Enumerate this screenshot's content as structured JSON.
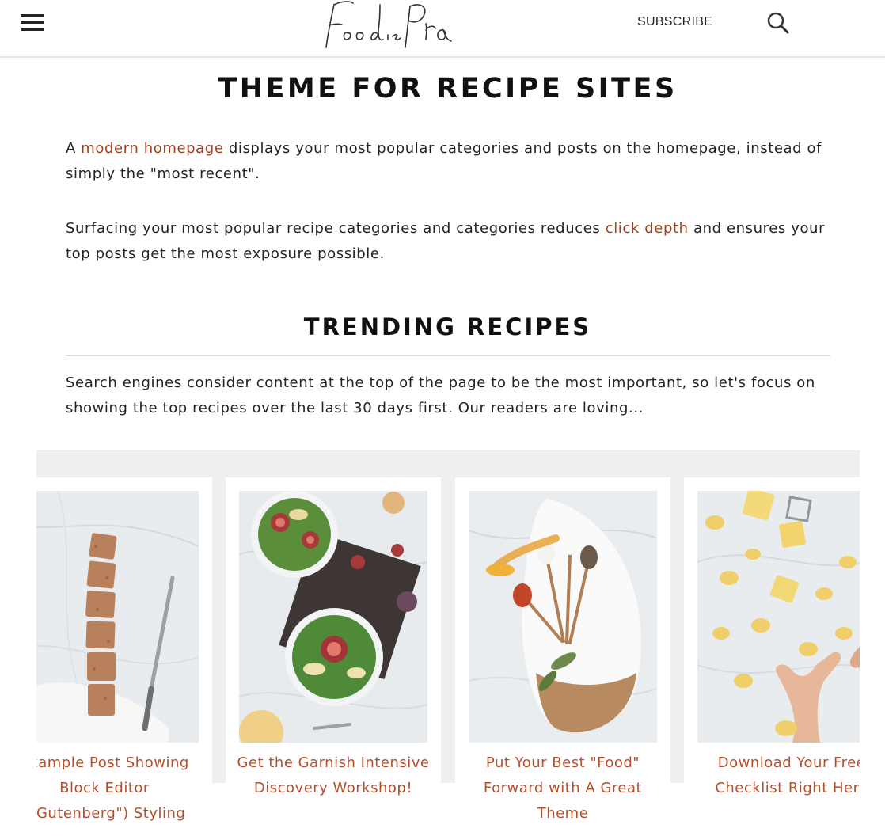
{
  "header": {
    "menu_icon": "hamburger-menu-icon",
    "logo_text": "Foodie Pro",
    "subscribe_label": "SUBSCRIBE",
    "search_icon": "search-icon"
  },
  "page_title": "THEME FOR RECIPE SITES",
  "intro": {
    "p1_prefix": "A ",
    "p1_link": "modern homepage",
    "p1_suffix": " displays your most popular categories and posts on the homepage, instead of simply the \"most recent\".",
    "p2_prefix": "Surfacing your most popular recipe categories and categories reduces ",
    "p2_link": "click depth",
    "p2_suffix": " and ensures your top posts get the most exposure possible."
  },
  "trending": {
    "title": "TRENDING RECIPES",
    "description": "Search engines consider content at the top of the page to be the most important, so let's focus on showing the top recipes over the last 30 days first. Our readers are loving...",
    "cards": [
      {
        "title_line1": "Example Post Showing",
        "title_line2": "Block Editor",
        "title_line3": "(\"Gutenberg\") Styling"
      },
      {
        "title_line1": "Get the Garnish Intensive",
        "title_line2": "Discovery Workshop!",
        "title_line3": ""
      },
      {
        "title_line1": "Put Your Best \"Food\"",
        "title_line2": "Forward with A Great",
        "title_line3": "Theme"
      },
      {
        "title_line1": "Download Your Free",
        "title_line2": "Checklist Right Here",
        "title_line3": ""
      }
    ]
  },
  "colors": {
    "link": "#a0401c",
    "card_title": "#b24f2d",
    "carousel_bg": "#efefef"
  }
}
